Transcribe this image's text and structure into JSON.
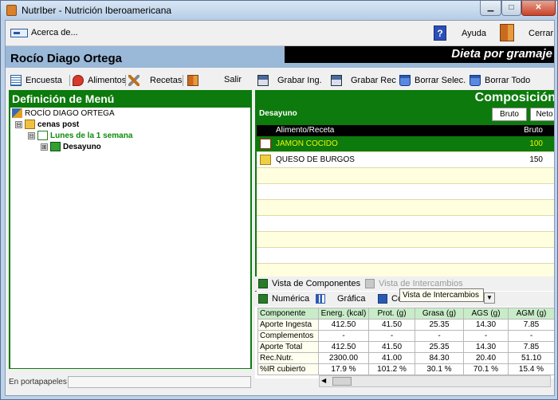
{
  "window": {
    "title": "NutrIber - Nutrición Iberoamericana",
    "min": "▁",
    "max": "□",
    "close": "✕"
  },
  "topbar": {
    "about": "Acerca de...",
    "help": "Ayuda",
    "close": "Cerrar",
    "help_glyph": "?"
  },
  "patient": {
    "name": "Rocío Diago Ortega",
    "mode": "Dieta por gramaje"
  },
  "left_toolbar": {
    "encuesta": "Encuesta",
    "alimentos": "Alimentos",
    "recetas": "Recetas",
    "salir": "Salir"
  },
  "right_toolbar": {
    "grabar_ing": "Grabar Ing.",
    "grabar_rec": "Grabar Rec",
    "borrar_sel": "Borrar Selec.",
    "borrar_todo": "Borrar Todo"
  },
  "menu_def": {
    "title": "Definición de Menú",
    "tree": {
      "root": "ROCÍO DIAGO ORTEGA",
      "plan": "cenas post",
      "day": "Lunes de la 1 semana",
      "meal": "Desayuno",
      "expand": "⊟",
      "collapse": "⊞"
    }
  },
  "composition": {
    "title": "Composición",
    "meal": "Desayuno",
    "bruto_button": "Bruto",
    "neto_button": "Neto",
    "columns": [
      "Alimento/Receta",
      "Bruto"
    ],
    "rows": [
      {
        "name": "JAMON COCIDO",
        "value": "100",
        "icon": "ham-icon"
      },
      {
        "name": "QUESO DE BURGOS",
        "value": "150",
        "icon": "cheese-icon"
      }
    ]
  },
  "views": {
    "components": "Vista de Componentes",
    "exchanges": "Vista de Intercambios"
  },
  "nutrition_tabs": {
    "numeric": "Numérica",
    "graphic": "Gráfica",
    "config": "Co"
  },
  "tooltip": "Vista de Intercambios",
  "nutrients": {
    "headers": [
      "Componente",
      "Energ. (kcal)",
      "Prot. (g)",
      "Grasa (g)",
      "AGS (g)",
      "AGM (g)"
    ],
    "rows": [
      [
        "Aporte Ingesta",
        "412.50",
        "41.50",
        "25.35",
        "14.30",
        "7.85"
      ],
      [
        "Complementos",
        "-",
        "-",
        "-",
        "-",
        "-"
      ],
      [
        "Aporte Total",
        "412.50",
        "41.50",
        "25.35",
        "14.30",
        "7.85"
      ],
      [
        "Rec.Nutr.",
        "2300.00",
        "41.00",
        "84.30",
        "20.40",
        "51.10"
      ],
      [
        "%IR cubierto",
        "17.9 %",
        "101.2 %",
        "30.1 %",
        "70.1 %",
        "15.4 %"
      ]
    ]
  },
  "status": {
    "clipboard": "En portapapeles"
  },
  "colors": {
    "green": "#0c7a0c",
    "patient_bar": "#9ab8d8",
    "highlight": "#f4f400"
  }
}
